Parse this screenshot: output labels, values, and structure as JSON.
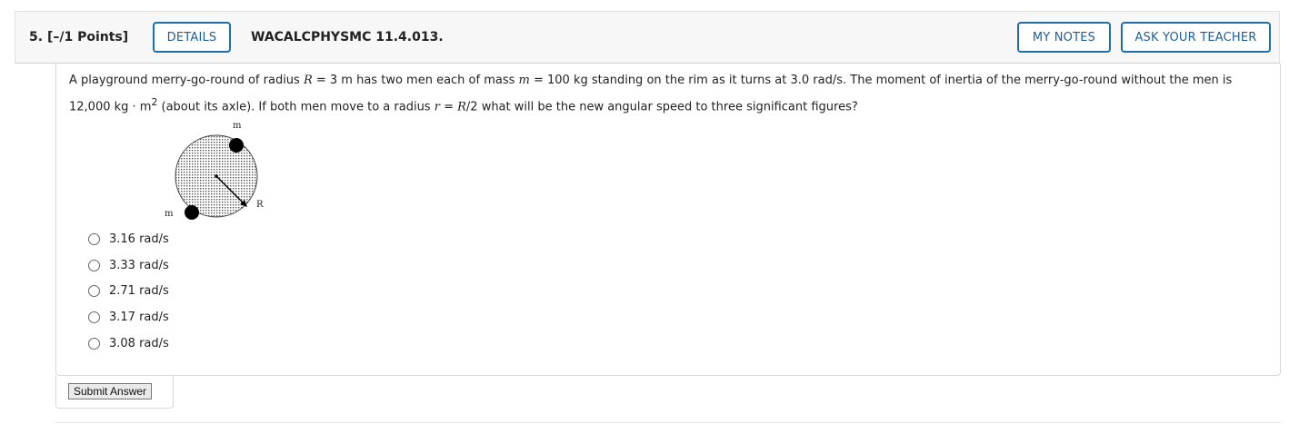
{
  "question": {
    "number": "5.",
    "points": "[–/1 Points]",
    "code": "WACALCPHYSMC 11.4.013."
  },
  "buttons": {
    "details": "DETAILS",
    "my_notes": "MY NOTES",
    "ask_teacher": "ASK YOUR TEACHER",
    "submit": "Submit Answer"
  },
  "prompt": {
    "p1": "A playground merry-go-round of radius ",
    "var_R": "R",
    "p2": " = 3 m has two men each of mass ",
    "var_m": "m",
    "p3": " = 100 kg standing on the rim as it turns at 3.0 rad/s. The moment of inertia of the merry-go-round without the men is 12,000 kg · m",
    "sup": "2",
    "p4": " (about its axle). If both men move to a radius ",
    "var_r": "r",
    "p5": " = ",
    "var_R2": "R",
    "p6": "/2 what will be the new angular speed to three significant figures?"
  },
  "figure": {
    "label_top": "m",
    "label_bottom": "m",
    "label_radius": "R"
  },
  "choices": [
    "3.16 rad/s",
    "3.33 rad/s",
    "2.71 rad/s",
    "3.17 rad/s",
    "3.08 rad/s"
  ]
}
